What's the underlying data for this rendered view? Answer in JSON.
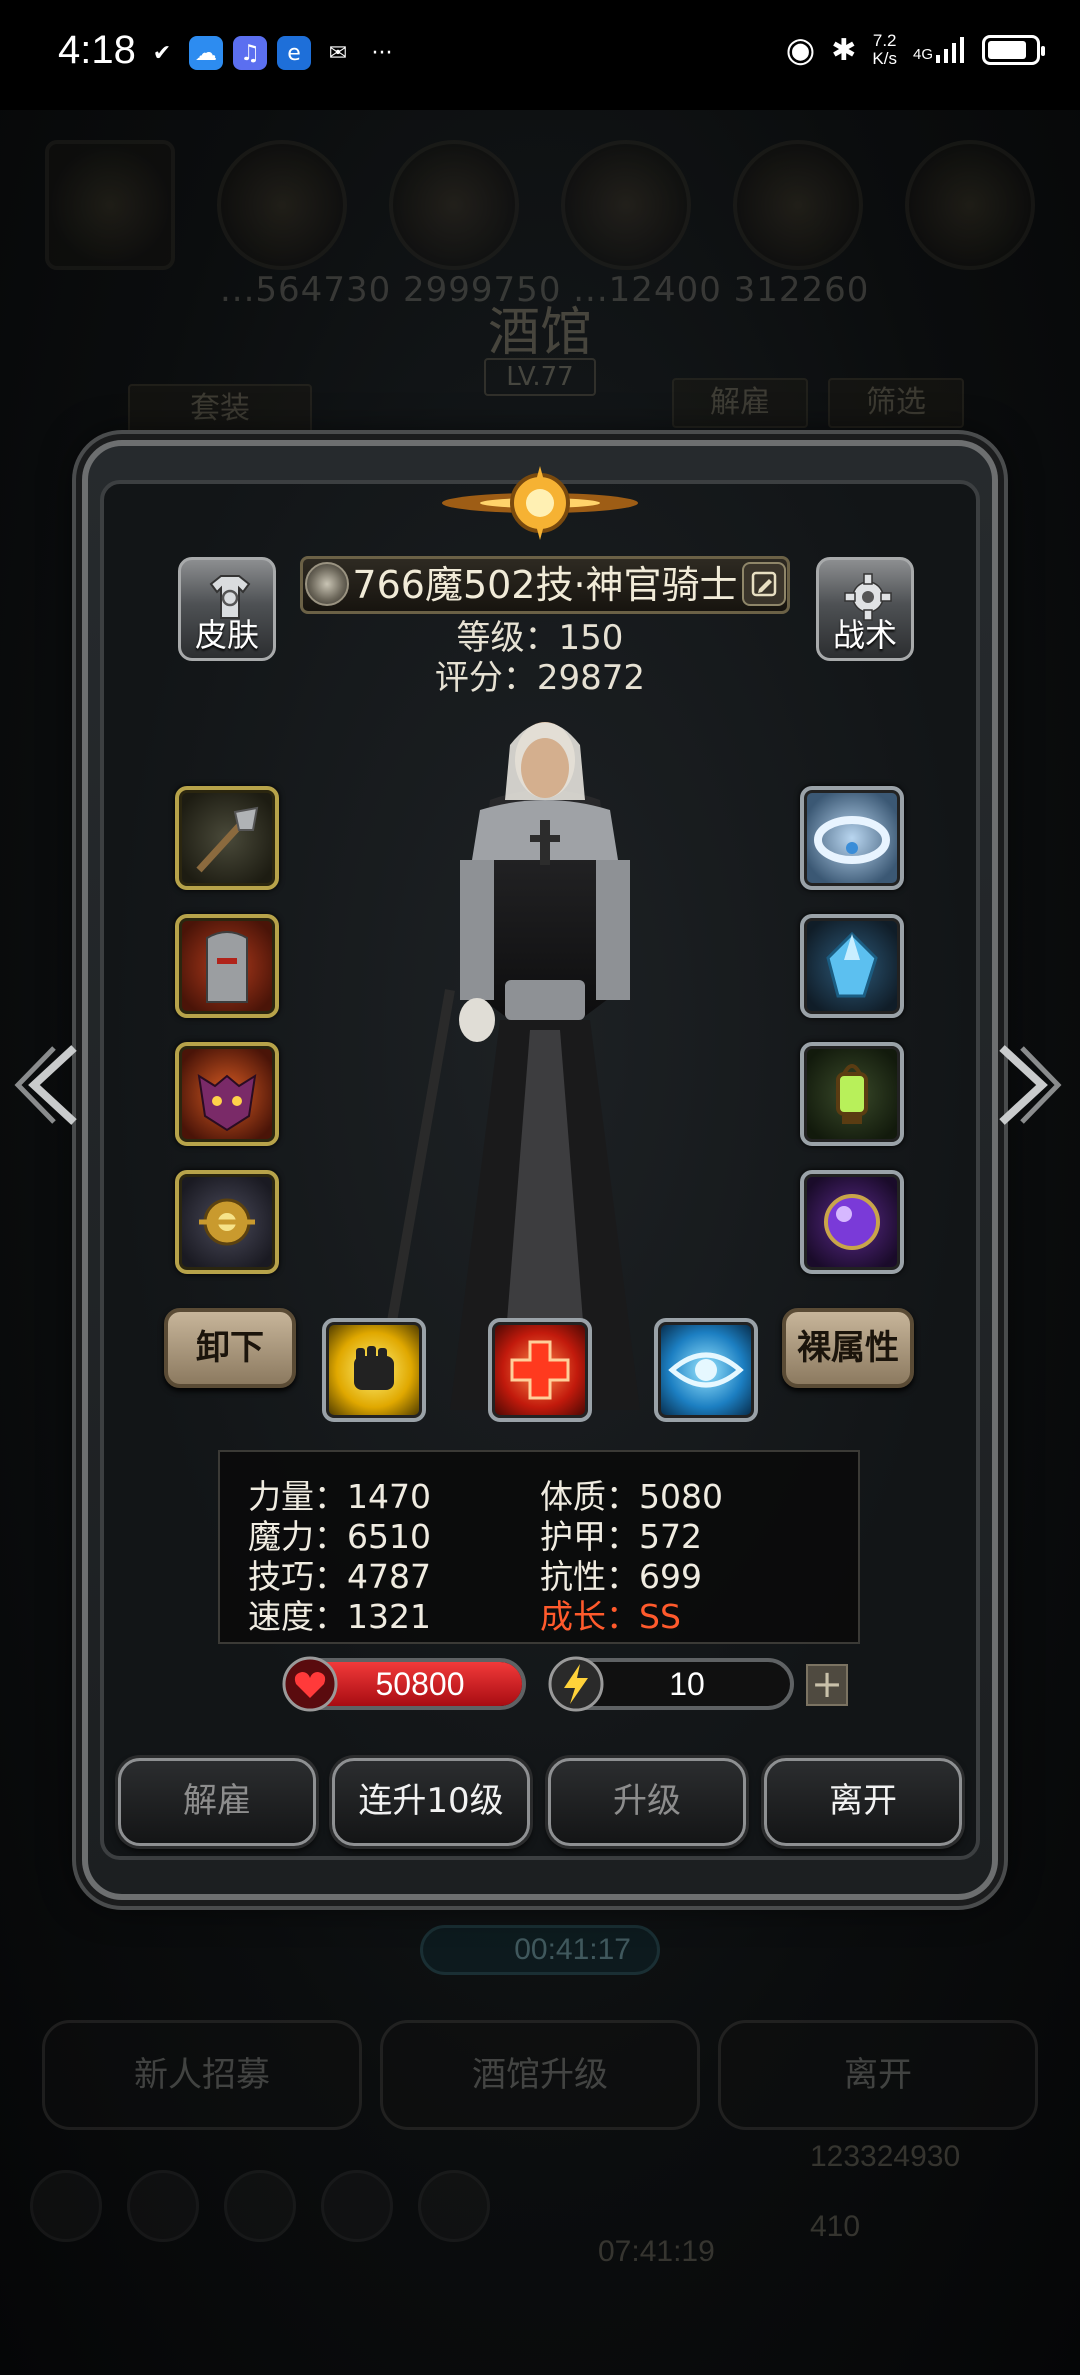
{
  "status_bar": {
    "time": "4:18",
    "more": "···",
    "net_speed_value": "7.2",
    "net_speed_unit": "K/s",
    "signal": "4G",
    "battery_level": 0.85
  },
  "background": {
    "title": "酒馆",
    "level": "LV.77",
    "numbers": "...564730  2999750  ...12400  312260",
    "outfit_button": "套装",
    "dismiss_button": "解雇",
    "filter_button": "筛选",
    "timer": "00:41:17",
    "recruit_button": "新人招募",
    "upgrade_tavern_button": "酒馆升级",
    "leave_button": "离开",
    "gift_timer": "07:41:19",
    "gold": "123324930",
    "gems": "410"
  },
  "hero": {
    "name": "766魔502技·神官骑士",
    "level_text": "等级：150",
    "score_text": "评分：29872",
    "skin_button": "皮肤",
    "tactics_button": "战术"
  },
  "equipment": {
    "left": [
      "mace",
      "helmet-armor",
      "demon-mask",
      "golden-amulet"
    ],
    "right": [
      "ice-crown",
      "blue-crystal",
      "green-lantern",
      "purple-orb"
    ]
  },
  "skill_row": {
    "unequip_button": "卸下",
    "base_stats_button": "裸属性",
    "skills": [
      "fist-skill",
      "heal-cross-skill",
      "eye-skill"
    ]
  },
  "stats": {
    "strength": "力量：1470",
    "magic": "魔力：6510",
    "skill": "技巧：4787",
    "speed": "速度：1321",
    "constitution": "体质：5080",
    "armor": "护甲：572",
    "resistance": "抗性：699",
    "growth": "成长：SS"
  },
  "bars": {
    "hp": "50800",
    "energy": "10",
    "energy_fraction": 0.1,
    "plus": "+"
  },
  "actions": {
    "dismiss": "解雇",
    "level_up_10": "连升10级",
    "level_up": "升级",
    "leave": "离开"
  },
  "colors": {
    "growth": "#ff5a2c",
    "hp_bar": "#c3121a",
    "energy_bar": "#f3d11b"
  }
}
